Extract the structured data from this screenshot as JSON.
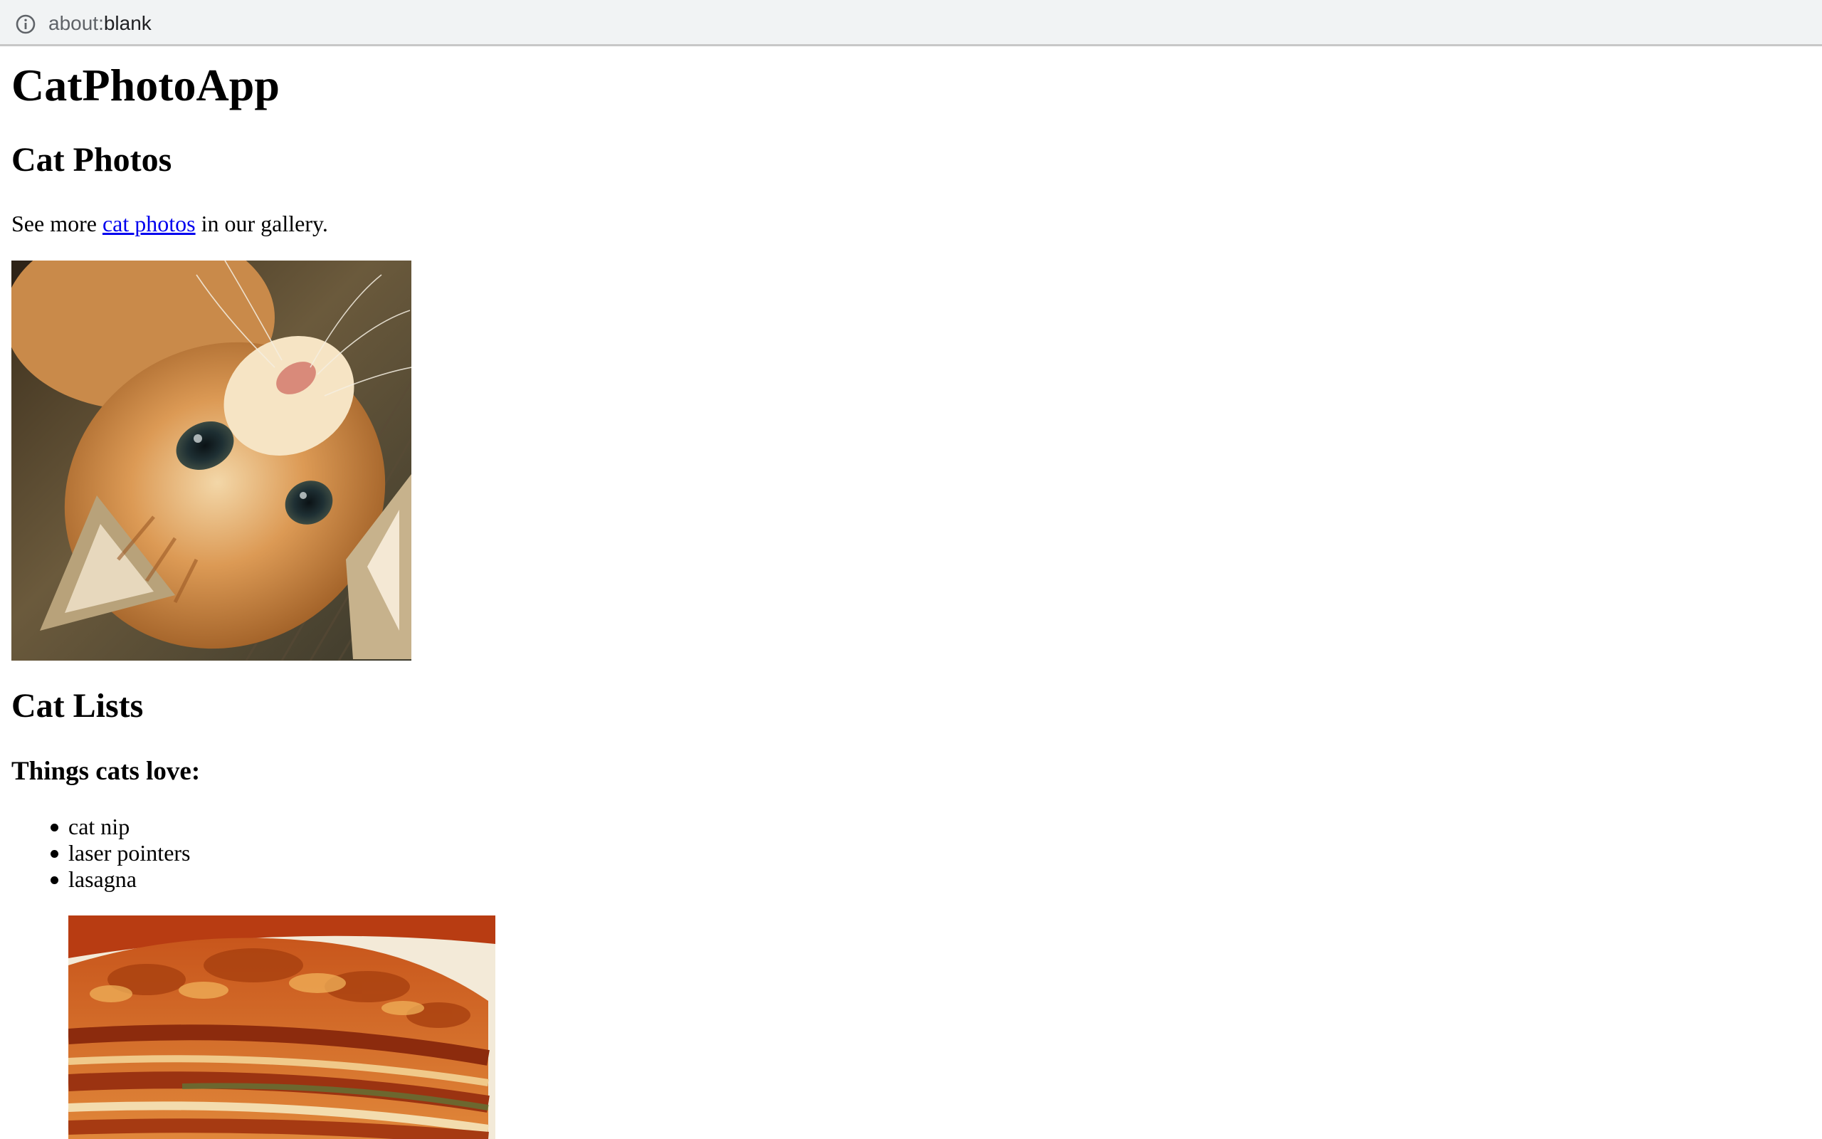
{
  "browser": {
    "url_scheme": "about:",
    "url_path": "blank",
    "info_icon": "info-circle-icon"
  },
  "page": {
    "title": "CatPhotoApp",
    "photos_heading": "Cat Photos",
    "gallery_text_before": "See more ",
    "gallery_link": "cat photos",
    "gallery_text_after": " in our gallery.",
    "cat_image": "kitten-photo",
    "lists_heading": "Cat Lists",
    "love_heading": "Things cats love:",
    "love_items": [
      "cat nip",
      "laser pointers",
      "lasagna"
    ],
    "lasagna_image": "lasagna-photo"
  }
}
